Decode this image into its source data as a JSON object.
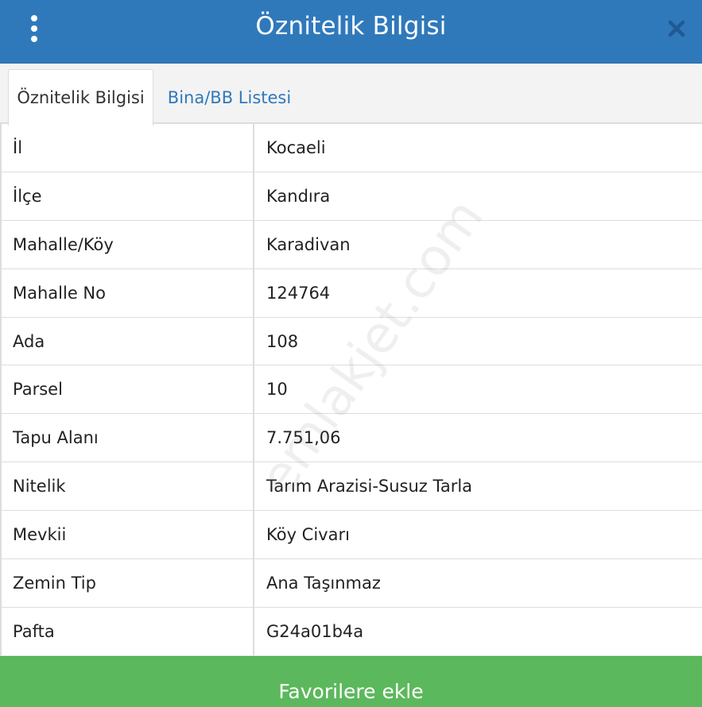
{
  "header": {
    "title": "Öznitelik Bilgisi",
    "menu_icon": "kebab-menu-icon",
    "close_icon": "close-icon",
    "background": "#2f79bb"
  },
  "tabs": [
    {
      "label": "Öznitelik Bilgisi",
      "active": true
    },
    {
      "label": "Bina/BB Listesi",
      "active": false
    }
  ],
  "attributes": [
    {
      "label": "İl",
      "value": "Kocaeli"
    },
    {
      "label": "İlçe",
      "value": "Kandıra"
    },
    {
      "label": "Mahalle/Köy",
      "value": "Karadivan"
    },
    {
      "label": "Mahalle No",
      "value": "124764"
    },
    {
      "label": "Ada",
      "value": "108"
    },
    {
      "label": "Parsel",
      "value": "10"
    },
    {
      "label": "Tapu Alanı",
      "value": "7.751,06"
    },
    {
      "label": "Nitelik",
      "value": "Tarım Arazisi-Susuz Tarla"
    },
    {
      "label": "Mevkii",
      "value": "Köy Civarı"
    },
    {
      "label": "Zemin Tip",
      "value": "Ana Taşınmaz"
    },
    {
      "label": "Pafta",
      "value": "G24a01b4a"
    }
  ],
  "watermark": "emlakjet.com",
  "footer": {
    "favorite_label": "Favorilere ekle",
    "background": "#5cb85c"
  }
}
